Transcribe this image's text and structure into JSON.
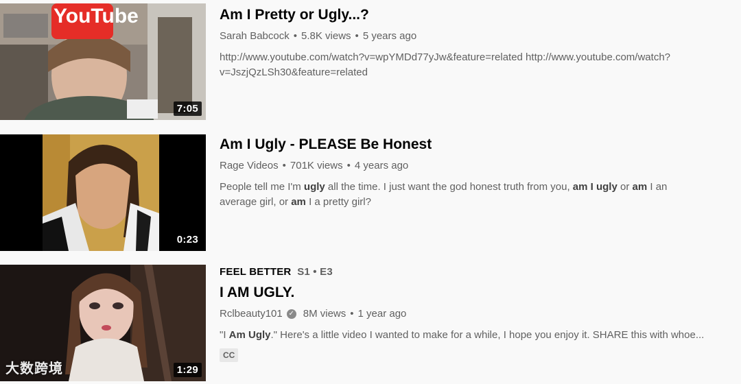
{
  "results": [
    {
      "title": "Am I Pretty or Ugly...?",
      "channel": "Sarah Babcock",
      "views": "5.8K views",
      "age": "5 years ago",
      "description_line1": "http://www.youtube.com/watch?v=wpYMDd77yJw&feature=related http://www.youtube.com/watch?",
      "description_line2": "v=JszjQzLSh30&feature=related",
      "duration": "7:05",
      "thumb_overlay_text": "YouTube"
    },
    {
      "title": "Am I Ugly - PLEASE Be Honest",
      "channel": "Rage Videos",
      "views": "701K views",
      "age": "4 years ago",
      "description": {
        "p1": "People tell me I'm ",
        "b1": "ugly",
        "p2": " all the time. I just want the god honest truth from you, ",
        "b2": "am I ugly",
        "p3": " or ",
        "b3": "am",
        "p4": " I an",
        "p5": "average girl, or ",
        "b4": "am",
        "p6": " I a pretty girl?"
      },
      "duration": "0:23"
    },
    {
      "badge_series": "FEEL BETTER",
      "badge_episode": "S1 • E3",
      "title": "I AM UGLY.",
      "channel": "Rclbeauty101",
      "verified_icon": "check-circle-icon",
      "views": "8M views",
      "age": "1 year ago",
      "description": {
        "p1": "\"I ",
        "b1": "Am Ugly",
        "p2": ".\" Here's a little video I wanted to make for a while, I hope you enjoy it. SHARE this with whoe..."
      },
      "cc_label": "CC",
      "duration": "1:29"
    }
  ],
  "watermark": "大数跨境",
  "separator": "•",
  "colors": {
    "background": "#f9f9f9",
    "title": "#030303",
    "meta": "#606060"
  }
}
